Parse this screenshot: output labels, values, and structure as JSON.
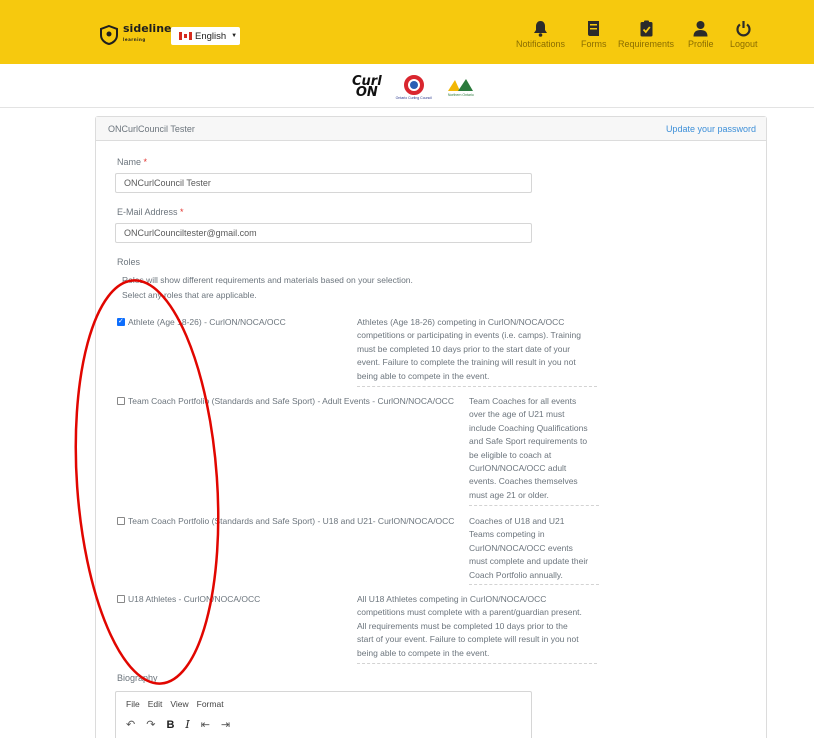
{
  "header": {
    "brand_name": "sideline",
    "brand_sub": "learning",
    "language": "English",
    "nav": [
      {
        "label": "Notifications",
        "icon": "bell-icon"
      },
      {
        "label": "Forms",
        "icon": "scroll-icon"
      },
      {
        "label": "Requirements",
        "icon": "clipboard-check-icon"
      },
      {
        "label": "Profile",
        "icon": "user-icon"
      },
      {
        "label": "Logout",
        "icon": "power-icon"
      }
    ],
    "colors": {
      "bar": "#f6c90e",
      "nav_text": "#8a6d00"
    }
  },
  "logos": {
    "curl_top": "Curl",
    "curl_bottom": "ON",
    "occ": "Ontario Curling Council",
    "noca": "Northern Ontario"
  },
  "card": {
    "title": "ONCurlCouncil Tester",
    "update_password": "Update your password"
  },
  "form": {
    "name_label": "Name",
    "name_value": "ONCurlCouncil Tester",
    "email_label": "E-Mail Address",
    "email_value": "ONCurlCounciltester@gmail.com",
    "required_mark": "*",
    "roles_label": "Roles",
    "roles_help_1": "Roles will show different requirements and materials based on your selection.",
    "roles_help_2": "Select any roles that are applicable.",
    "roles": [
      {
        "label": "Athlete (Age 18-26) - CurlON/NOCA/OCC",
        "checked": true,
        "description": [
          "Athletes (Age 18-26) competing in CurlON/NOCA/OCC",
          "competitions or participating in events (i.e. camps). Training",
          "must be completed 10 days prior to the start date of your",
          "event. Failure to complete the training will result in you not",
          "being able to compete in the event."
        ]
      },
      {
        "label": "Team Coach Portfolio (Standards and Safe Sport) - Adult Events - CurlON/NOCA/OCC",
        "checked": false,
        "description": [
          "Team Coaches for all events",
          "over the age of U21 must",
          "include Coaching Qualifications",
          "and Safe Sport requirements to",
          "be eligible to coach at",
          "CurlON/NOCA/OCC adult",
          "events. Coaches themselves",
          "must age 21 or older."
        ]
      },
      {
        "label": "Team Coach Portfolio (Standards and Safe Sport) - U18 and U21- CurlON/NOCA/OCC",
        "checked": false,
        "description": [
          "Coaches of U18 and U21",
          "Teams competing in",
          "CurlON/NOCA/OCC events",
          "must complete and update their",
          "Coach Portfolio annually."
        ]
      },
      {
        "label": "U18 Athletes - CurlON/NOCA/OCC",
        "checked": false,
        "description": [
          "All U18 Athletes competing in CurlON/NOCA/OCC",
          "competitions must complete with a parent/guardian present.",
          "All requirements must be completed 10 days prior to the",
          "start of your event. Failure to complete will result in you not",
          "being able to compete in the event."
        ]
      }
    ],
    "bio_label": "Biography",
    "editor_menu": [
      "File",
      "Edit",
      "View",
      "Format"
    ]
  }
}
